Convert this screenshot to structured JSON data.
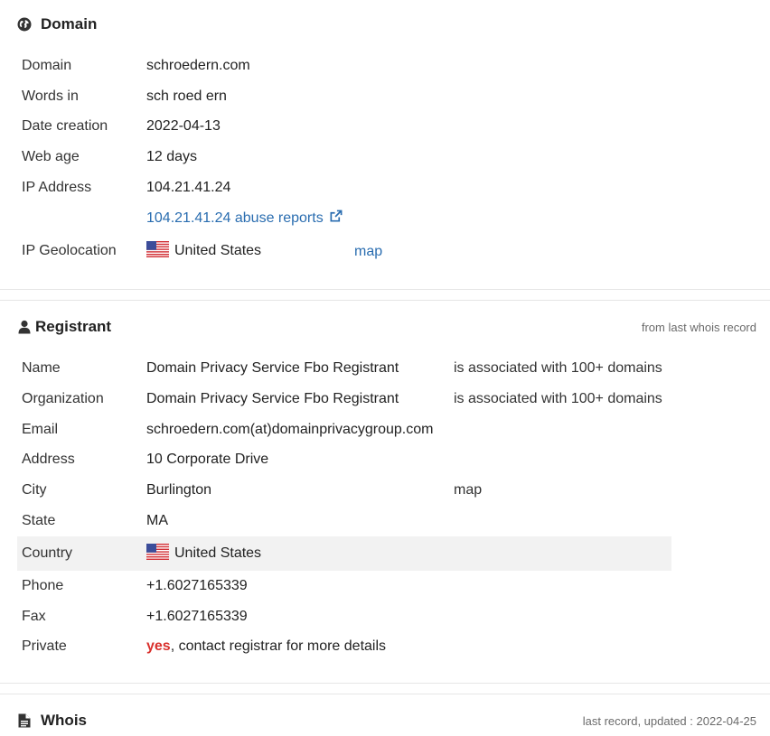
{
  "domain_section": {
    "title": "Domain",
    "icon": "globe-icon",
    "rows": {
      "domain": {
        "label": "Domain",
        "value": "schroedern.com"
      },
      "words": {
        "label": "Words in",
        "value": "sch roed ern"
      },
      "date_creation": {
        "label": "Date creation",
        "value": "2022-04-13"
      },
      "web_age": {
        "label": "Web age",
        "value": "12 days"
      },
      "ip_address": {
        "label": "IP Address",
        "value": "104.21.41.24"
      },
      "abuse": {
        "value": "104.21.41.24 abuse reports"
      },
      "geolocation": {
        "label": "IP Geolocation",
        "value": "United States",
        "map": "map"
      }
    }
  },
  "registrant_section": {
    "title": "Registrant",
    "icon": "user-icon",
    "note": "from last whois record",
    "rows": {
      "name": {
        "label": "Name",
        "value": "Domain Privacy Service Fbo Registrant",
        "extra": "is associated with 100+ domains"
      },
      "organization": {
        "label": "Organization",
        "value": "Domain Privacy Service Fbo Registrant",
        "extra": "is associated with 100+ domains"
      },
      "email": {
        "label": "Email",
        "value": "schroedern.com(at)domainprivacygroup.com"
      },
      "address": {
        "label": "Address",
        "value": "10 Corporate Drive"
      },
      "city": {
        "label": "City",
        "value": "Burlington",
        "map": "map"
      },
      "state": {
        "label": "State",
        "value": "MA"
      },
      "country": {
        "label": "Country",
        "value": "United States"
      },
      "phone": {
        "label": "Phone",
        "value": "+1.6027165339"
      },
      "fax": {
        "label": "Fax",
        "value": "+1.6027165339"
      },
      "private": {
        "label": "Private",
        "value_highlight": "yes",
        "value_rest": ", contact registrar for more details"
      }
    }
  },
  "whois_section": {
    "title": "Whois",
    "icon": "document-icon",
    "note": "last record, updated : 2022-04-25"
  },
  "colors": {
    "link": "#2a6db0",
    "highlight_red": "#d9302c",
    "shaded_row": "#f2f2f2",
    "divider": "#e6e6e6"
  }
}
